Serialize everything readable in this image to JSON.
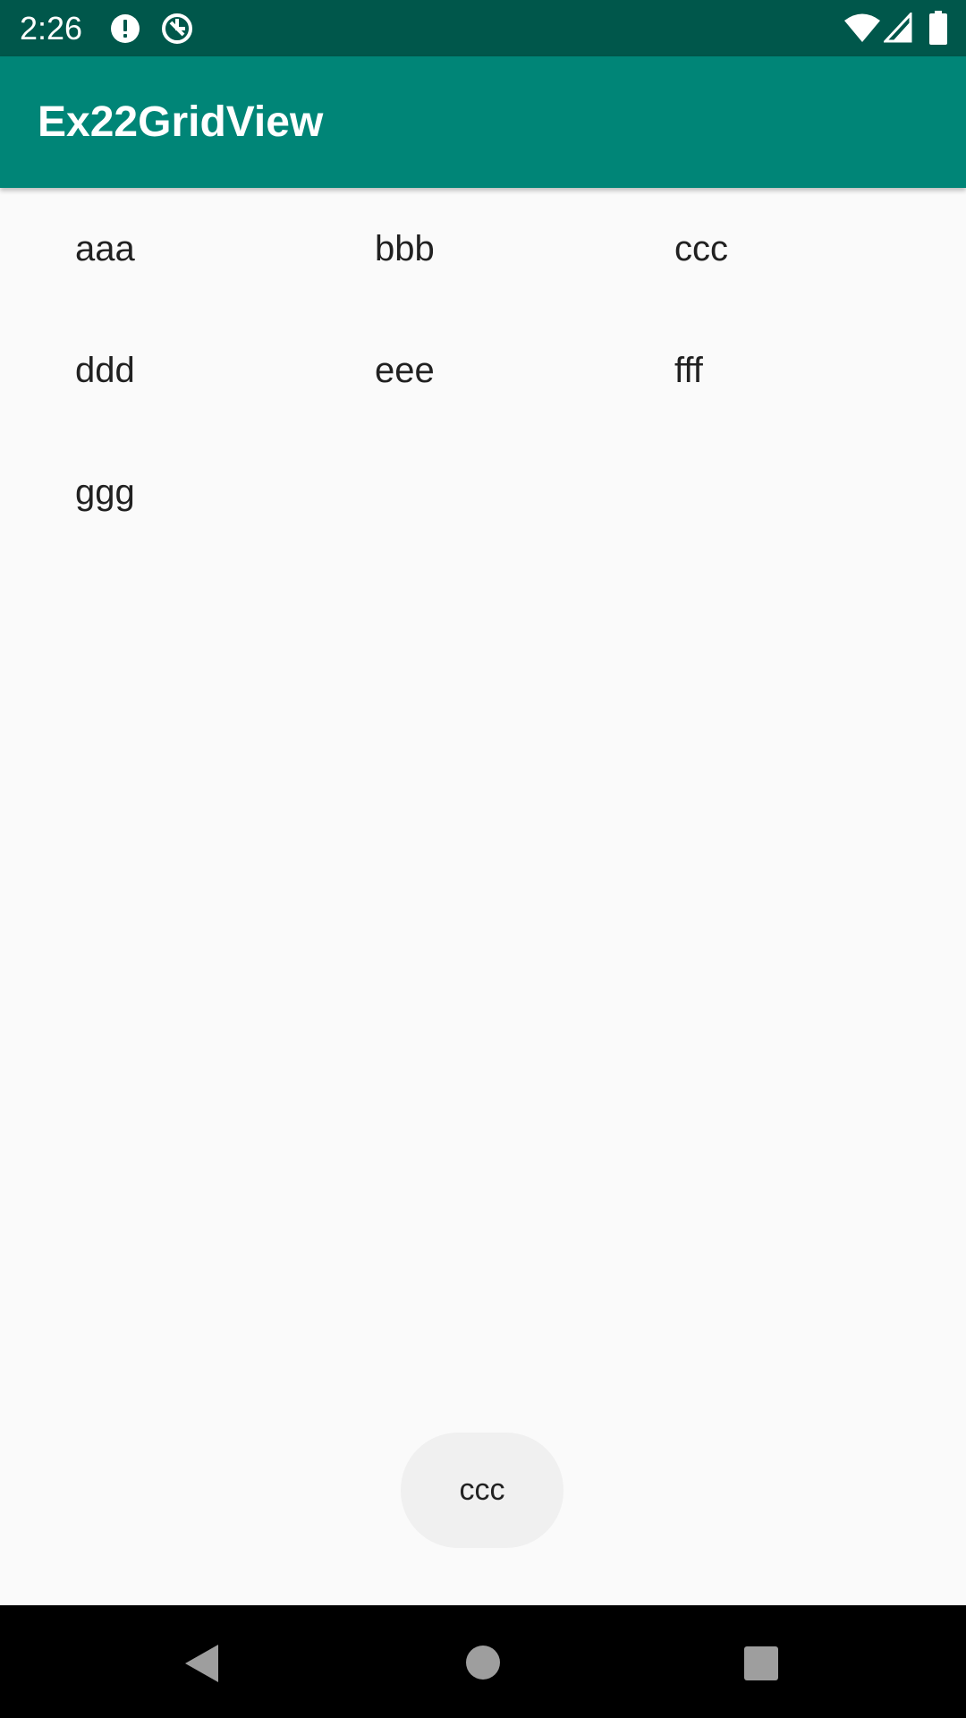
{
  "status_bar": {
    "time": "2:26",
    "icons": [
      "alert-icon",
      "data-saver-icon",
      "wifi-icon",
      "signal-icon",
      "battery-icon"
    ]
  },
  "app_bar": {
    "title": "Ex22GridView"
  },
  "grid": {
    "items": [
      "aaa",
      "bbb",
      "ccc",
      "ddd",
      "eee",
      "fff",
      "ggg"
    ]
  },
  "toast": {
    "text": "ccc"
  },
  "nav_bar": {
    "icons": [
      "back-icon",
      "home-icon",
      "recents-icon"
    ]
  },
  "colors": {
    "status_bar": "#00574B",
    "app_bar": "#008577",
    "background": "#FAFAFA",
    "toast": "#F0F0F0"
  }
}
